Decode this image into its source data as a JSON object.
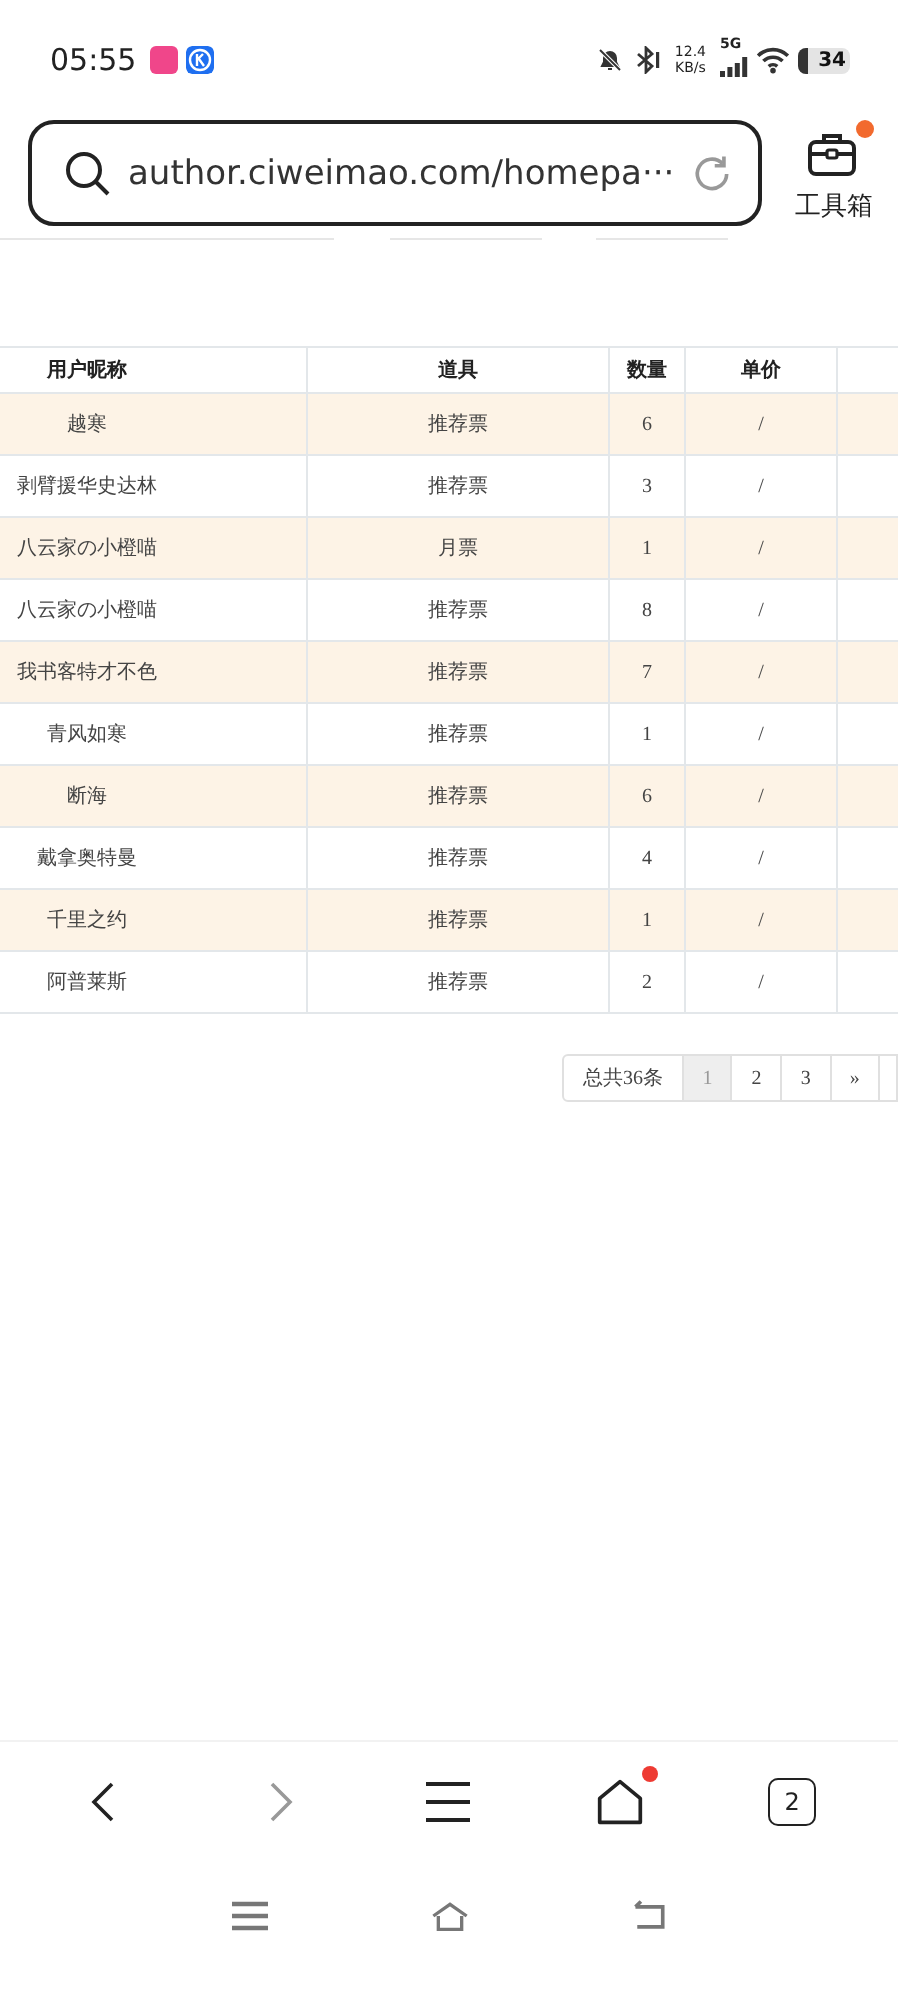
{
  "status_bar": {
    "time": "05:55",
    "net_speed": "12.4",
    "net_unit": "KB/s",
    "network": "5G",
    "battery": "34"
  },
  "address_bar": {
    "url": "author.ciweimao.com/homepa···"
  },
  "toolbox": {
    "label": "工具箱",
    "badge": true
  },
  "table": {
    "columns": [
      "用户昵称",
      "道具",
      "数量",
      "单价"
    ],
    "rows": [
      {
        "cells": [
          "越寒",
          "推荐票",
          "6",
          "/"
        ],
        "highlighted": true
      },
      {
        "cells": [
          "剥臂援华史达林",
          "推荐票",
          "3",
          "/"
        ],
        "highlighted": false
      },
      {
        "cells": [
          "八云家の小橙喵",
          "月票",
          "1",
          "/"
        ],
        "highlighted": true
      },
      {
        "cells": [
          "八云家の小橙喵",
          "推荐票",
          "8",
          "/"
        ],
        "highlighted": false
      },
      {
        "cells": [
          "我书客特才不色",
          "推荐票",
          "7",
          "/"
        ],
        "highlighted": true
      },
      {
        "cells": [
          "青风如寒",
          "推荐票",
          "1",
          "/"
        ],
        "highlighted": false
      },
      {
        "cells": [
          "断海",
          "推荐票",
          "6",
          "/"
        ],
        "highlighted": true
      },
      {
        "cells": [
          "戴拿奥特曼",
          "推荐票",
          "4",
          "/"
        ],
        "highlighted": false
      },
      {
        "cells": [
          "千里之约",
          "推荐票",
          "1",
          "/"
        ],
        "highlighted": true
      },
      {
        "cells": [
          "阿普莱斯",
          "推荐票",
          "2",
          "/"
        ],
        "highlighted": false
      }
    ]
  },
  "pagination": {
    "total": "总共36条",
    "pages": [
      {
        "label": "1",
        "selected": true
      },
      {
        "label": "2",
        "selected": false
      },
      {
        "label": "3",
        "selected": false
      }
    ],
    "next": "»"
  },
  "bottom_nav": {
    "home_badge": true,
    "tabs_count": "2"
  }
}
